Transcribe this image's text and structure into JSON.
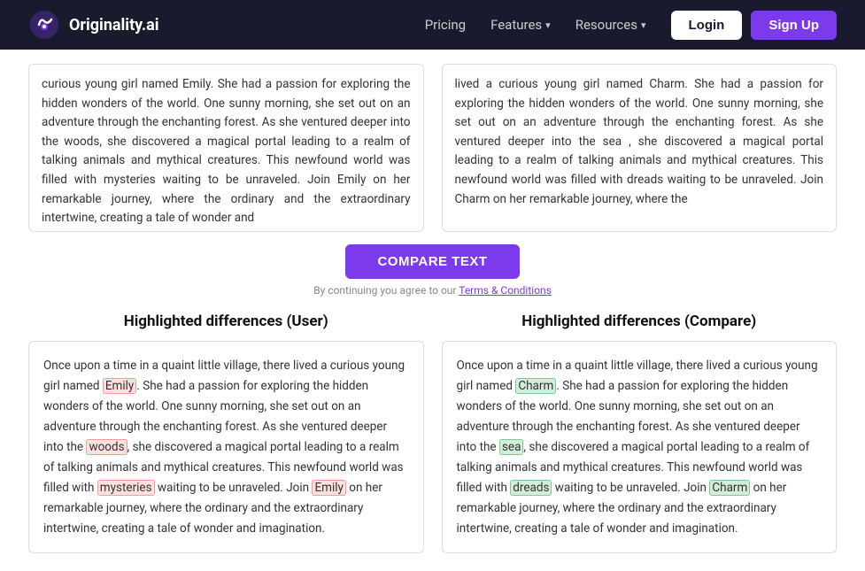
{
  "nav": {
    "logo_text": "Originality.ai",
    "pricing": "Pricing",
    "features": "Features",
    "resources": "Resources",
    "login": "Login",
    "signup": "Sign Up"
  },
  "textarea_left": "curious young girl named Emily. She had a passion for exploring the hidden wonders of the world. One sunny morning, she set out on an adventure through the enchanting forest. As she ventured deeper into the woods, she discovered a magical portal leading to a realm of talking animals and mythical creatures. This newfound world was filled with mysteries waiting to be unraveled. Join Emily on her remarkable journey, where the ordinary and the extraordinary intertwine, creating a tale of wonder and",
  "textarea_right": "lived a curious young girl named Charm. She had a passion for exploring the hidden wonders of the world. One sunny morning, she set out on an adventure through the enchanting forest. As she ventured deeper into the sea , she discovered a magical portal leading to a realm of talking animals and mythical creatures. This newfound world was filled with dreads waiting to be unraveled. Join Charm on her remarkable journey, where the",
  "compare_button": "COMPARE TEXT",
  "terms_text": "By continuing you agree to our",
  "terms_link": "Terms & Conditions",
  "diff_left_title": "Highlighted differences (User)",
  "diff_right_title": "Highlighted differences (Compare)",
  "diff_left_text_parts": [
    {
      "text": "Once upon a time in a quaint little village, there lived a curious young girl named ",
      "highlight": null
    },
    {
      "text": "Emily",
      "highlight": "red"
    },
    {
      "text": ". She had a passion for exploring the hidden wonders of the world. One sunny morning, she set out on an adventure through the enchanting forest. As she ventured deeper into the ",
      "highlight": null
    },
    {
      "text": "woods",
      "highlight": "red"
    },
    {
      "text": ", she discovered a magical portal leading to a realm of talking animals and mythical creatures. This newfound world was filled with ",
      "highlight": null
    },
    {
      "text": "mysteries",
      "highlight": "red"
    },
    {
      "text": " waiting to be unraveled. Join ",
      "highlight": null
    },
    {
      "text": "Emily",
      "highlight": "red"
    },
    {
      "text": " on her remarkable journey, where the ordinary and the extraordinary intertwine, creating a tale of wonder and imagination.",
      "highlight": null
    }
  ],
  "diff_right_text_parts": [
    {
      "text": "Once upon a time in a quaint little village, there lived a curious young girl named ",
      "highlight": null
    },
    {
      "text": "Charm",
      "highlight": "green"
    },
    {
      "text": ". She had a passion for exploring the hidden wonders of the world. One sunny morning, she set out on an adventure through the enchanting forest. As she ventured deeper into the ",
      "highlight": null
    },
    {
      "text": "sea",
      "highlight": "green"
    },
    {
      "text": ", she discovered a magical portal leading to a realm of talking animals and mythical creatures. This newfound world was filled with ",
      "highlight": null
    },
    {
      "text": "dreads",
      "highlight": "green"
    },
    {
      "text": " waiting to be unraveled. Join ",
      "highlight": null
    },
    {
      "text": "Charm",
      "highlight": "green"
    },
    {
      "text": " on her remarkable journey, where the ordinary and the extraordinary intertwine, creating a tale of wonder and imagination.",
      "highlight": null
    }
  ]
}
